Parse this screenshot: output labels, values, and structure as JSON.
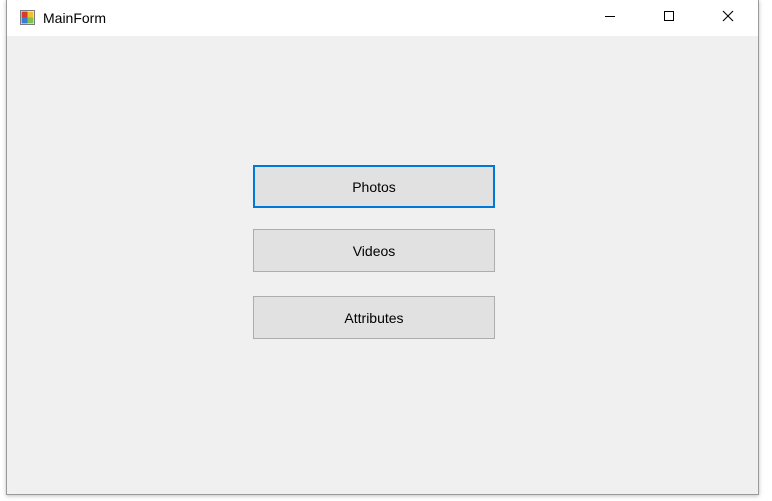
{
  "window": {
    "title": "MainForm",
    "controls": {
      "minimize_icon": "minimize-icon",
      "maximize_icon": "maximize-icon",
      "close_icon": "close-icon"
    }
  },
  "buttons": {
    "photos": "Photos",
    "videos": "Videos",
    "attributes": "Attributes"
  },
  "colors": {
    "client_background": "#f0f0f0",
    "button_face": "#e1e1e1",
    "button_border": "#adadad",
    "focus_border": "#0078d7"
  }
}
